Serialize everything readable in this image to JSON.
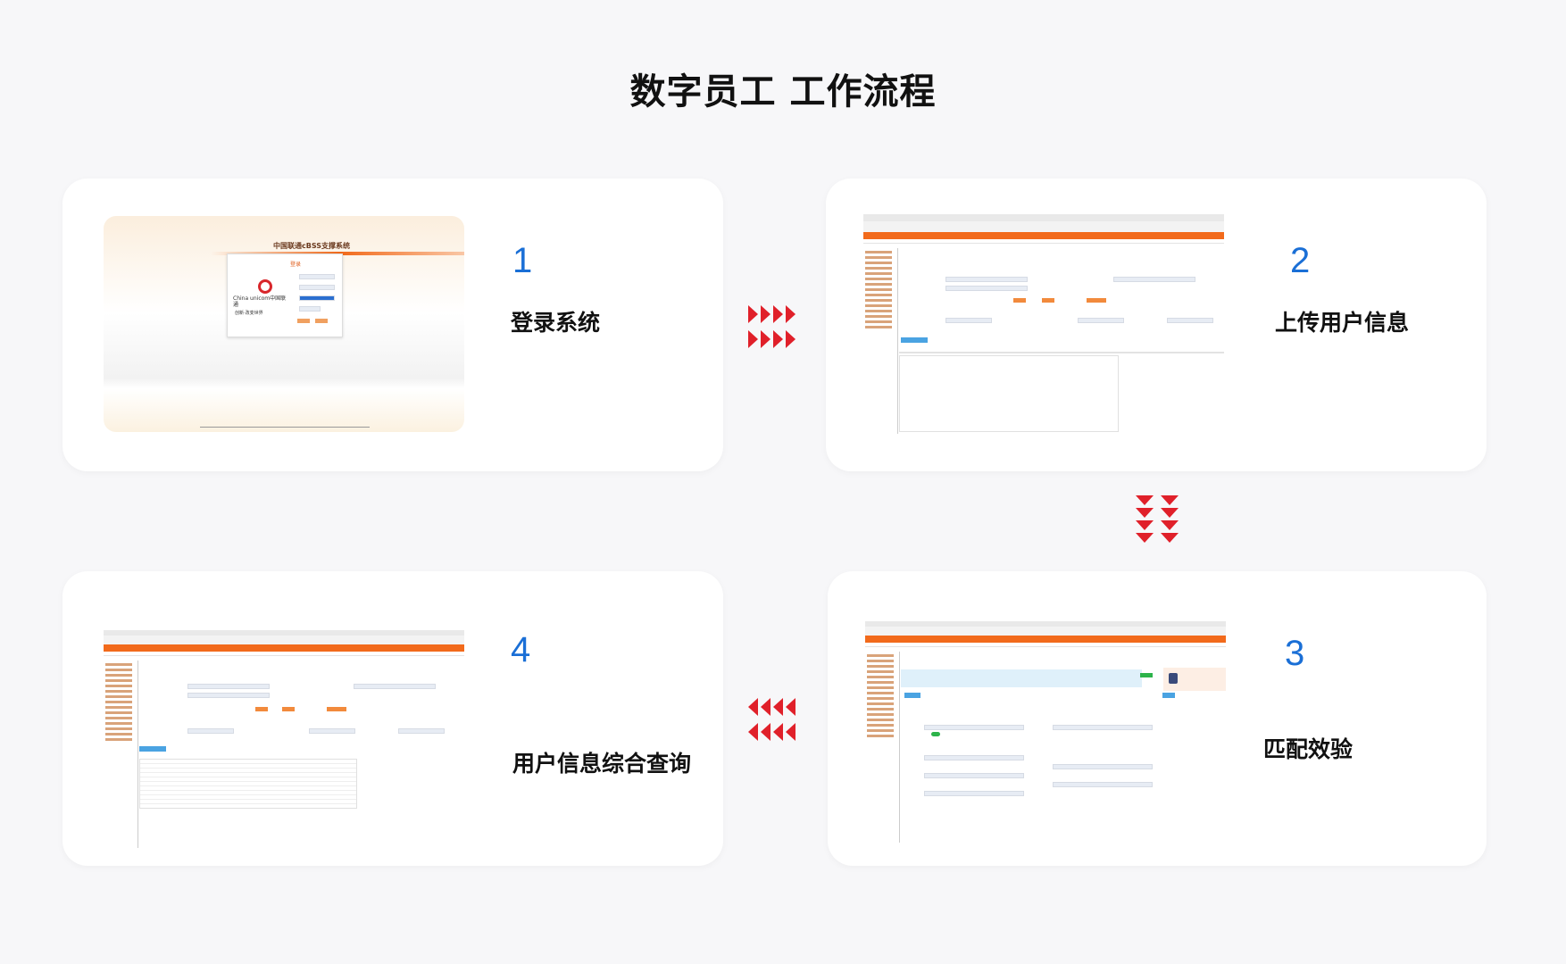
{
  "title": "数字员工 工作流程",
  "steps": [
    {
      "num": "1",
      "label": "登录系统"
    },
    {
      "num": "2",
      "label": "上传用户信息"
    },
    {
      "num": "3",
      "label": "匹配效验"
    },
    {
      "num": "4",
      "label": "用户信息综合查询"
    }
  ],
  "login_screen": {
    "system_title": "中国联通cBSS支撑系统",
    "login_heading": "登录",
    "logo_text": "China unicom中国联通",
    "slogan": "创新·改变世界"
  },
  "colors": {
    "accent_blue": "#1a6fd6",
    "arrow_red": "#e0202a",
    "brand_orange": "#f26a1b"
  }
}
